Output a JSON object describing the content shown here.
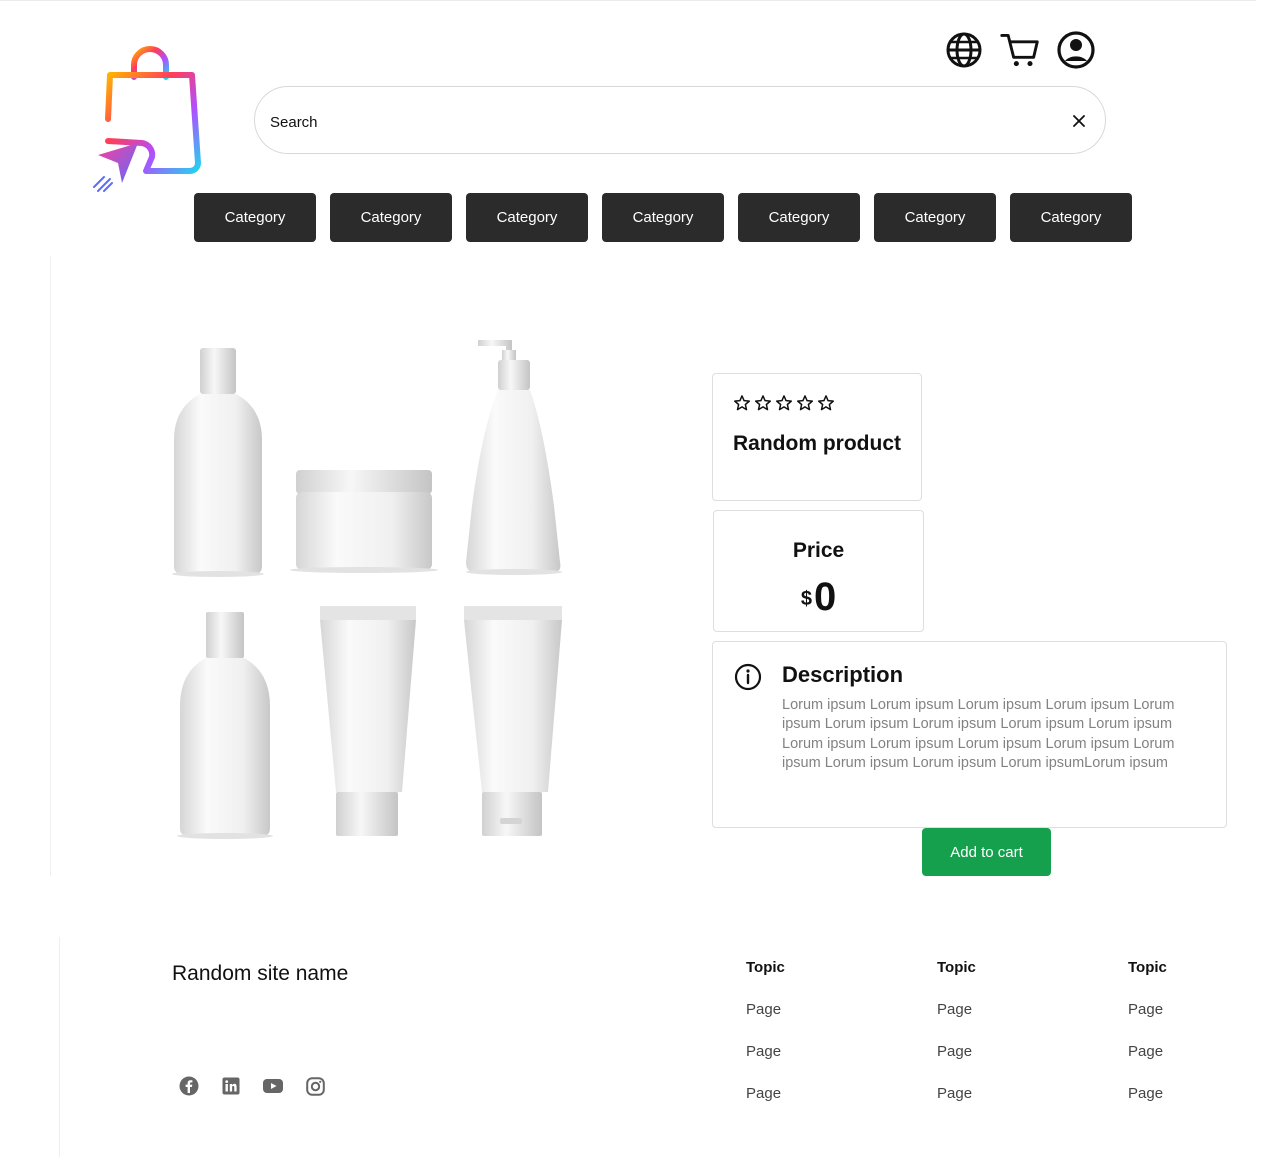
{
  "header": {
    "search": {
      "placeholder": "Search",
      "value": ""
    },
    "icons": [
      "globe-icon",
      "cart-icon",
      "account-icon"
    ]
  },
  "categories": [
    "Category",
    "Category",
    "Category",
    "Category",
    "Category",
    "Category",
    "Category"
  ],
  "product": {
    "rating": 0,
    "rating_max": 5,
    "name": "Random product",
    "price_label": "Price",
    "currency": "$",
    "price": "0",
    "description_title": "Description",
    "description": "Lorum ipsum Lorum ipsum Lorum ipsum Lorum ipsum Lorum ipsum Lorum ipsum Lorum ipsum Lorum ipsum Lorum ipsum Lorum ipsum Lorum ipsum Lorum ipsum Lorum ipsum Lorum ipsum Lorum ipsum Lorum ipsum Lorum ipsumLorum ipsum",
    "add_to_cart": "Add to cart"
  },
  "footer": {
    "site_name": "Random site name",
    "socials": [
      "facebook-icon",
      "linkedin-icon",
      "youtube-icon",
      "instagram-icon"
    ],
    "columns": [
      {
        "topic": "Topic",
        "pages": [
          "Page",
          "Page",
          "Page"
        ]
      },
      {
        "topic": "Topic",
        "pages": [
          "Page",
          "Page",
          "Page"
        ]
      },
      {
        "topic": "Topic",
        "pages": [
          "Page",
          "Page",
          "Page"
        ]
      }
    ]
  },
  "colors": {
    "category_bg": "#2b2b2b",
    "add_to_cart_bg": "#14a04d",
    "description_text": "#828282"
  }
}
